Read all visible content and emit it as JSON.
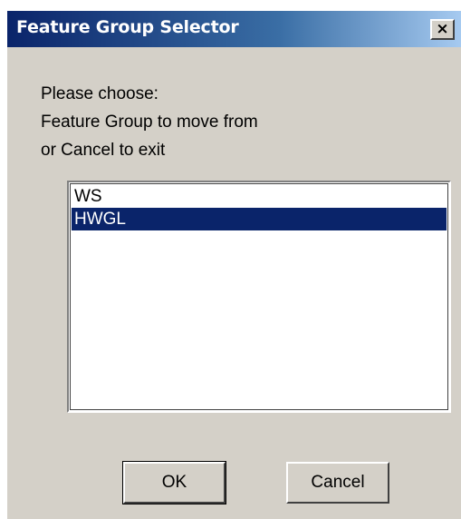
{
  "window": {
    "title": "Feature Group Selector",
    "close_label": "×"
  },
  "prompt": {
    "line1": "Please choose:",
    "line2": "Feature Group to move from",
    "line3": "or Cancel to exit"
  },
  "list": {
    "items": [
      {
        "label": "WS",
        "selected": false
      },
      {
        "label": "HWGL",
        "selected": true
      }
    ]
  },
  "buttons": {
    "ok_label": "OK",
    "cancel_label": "Cancel"
  },
  "colors": {
    "title_bar": "#0a246a",
    "dialog_face": "#d4d0c8",
    "selection": "#0a246a"
  }
}
